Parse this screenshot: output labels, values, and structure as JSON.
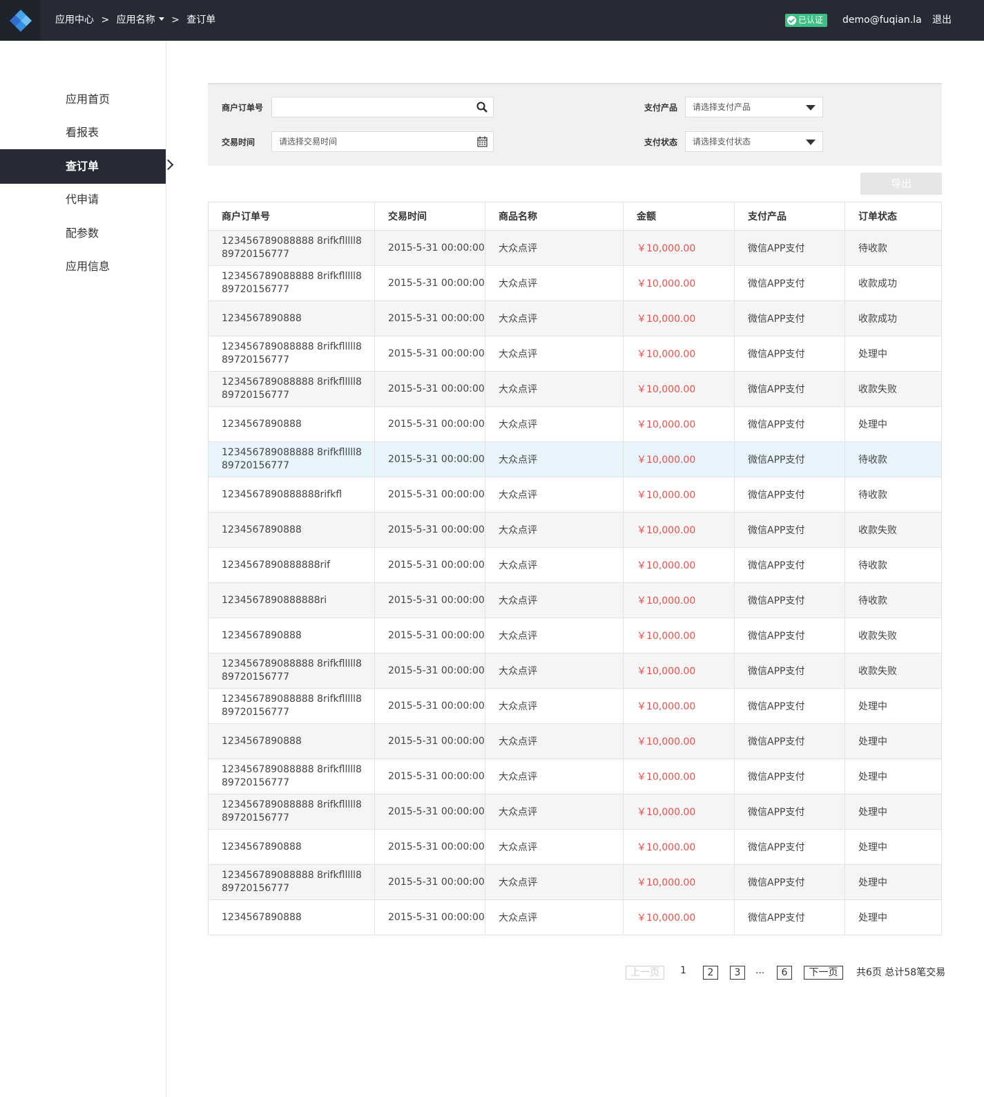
{
  "header": {
    "breadcrumb": [
      "应用中心",
      "应用名称",
      "查订单"
    ],
    "separator": ">",
    "verified_label": "已认证",
    "user_email": "demo@fuqian.la",
    "logout_label": "退出"
  },
  "sidebar": {
    "items": [
      {
        "label": "应用首页",
        "active": false
      },
      {
        "label": "看报表",
        "active": false
      },
      {
        "label": "查订单",
        "active": true
      },
      {
        "label": "代申请",
        "active": false
      },
      {
        "label": "配参数",
        "active": false
      },
      {
        "label": "应用信息",
        "active": false
      }
    ]
  },
  "filters": {
    "order_no_label": "商户订单号",
    "order_no_value": "",
    "time_label": "交易时间",
    "time_placeholder": "请选择交易时间",
    "product_label": "支付产品",
    "product_placeholder": "请选择支付产品",
    "status_label": "支付状态",
    "status_placeholder": "请选择支付状态"
  },
  "export_label": "导出",
  "table": {
    "columns": [
      "商户订单号",
      "交易时间",
      "商品名称",
      "金额",
      "支付产品",
      "订单状态"
    ],
    "rows": [
      {
        "order": "123456789088888 8rifkflllll889720156777",
        "time": "2015-5-31 00:00:00",
        "goods": "大众点评",
        "amount": "￥10,000.00",
        "product": "微信APP支付",
        "status": "待收款"
      },
      {
        "order": "123456789088888 8rifkflllll889720156777",
        "time": "2015-5-31 00:00:00",
        "goods": "大众点评",
        "amount": "￥10,000.00",
        "product": "微信APP支付",
        "status": "收款成功"
      },
      {
        "order": "1234567890888",
        "time": "2015-5-31 00:00:00",
        "goods": "大众点评",
        "amount": "￥10,000.00",
        "product": "微信APP支付",
        "status": "收款成功"
      },
      {
        "order": "123456789088888 8rifkflllll889720156777",
        "time": "2015-5-31 00:00:00",
        "goods": "大众点评",
        "amount": "￥10,000.00",
        "product": "微信APP支付",
        "status": "处理中"
      },
      {
        "order": "123456789088888 8rifkflllll889720156777",
        "time": "2015-5-31 00:00:00",
        "goods": "大众点评",
        "amount": "￥10,000.00",
        "product": "微信APP支付",
        "status": "收款失败"
      },
      {
        "order": "1234567890888",
        "time": "2015-5-31 00:00:00",
        "goods": "大众点评",
        "amount": "￥10,000.00",
        "product": "微信APP支付",
        "status": "处理中"
      },
      {
        "order": "123456789088888 8rifkflllll889720156777",
        "time": "2015-5-31 00:00:00",
        "goods": "大众点评",
        "amount": "￥10,000.00",
        "product": "微信APP支付",
        "status": "待收款",
        "highlight": true
      },
      {
        "order": "1234567890888888rifkfl",
        "time": "2015-5-31 00:00:00",
        "goods": "大众点评",
        "amount": "￥10,000.00",
        "product": "微信APP支付",
        "status": "待收款"
      },
      {
        "order": "1234567890888",
        "time": "2015-5-31 00:00:00",
        "goods": "大众点评",
        "amount": "￥10,000.00",
        "product": "微信APP支付",
        "status": "收款失败"
      },
      {
        "order": "1234567890888888rif",
        "time": "2015-5-31 00:00:00",
        "goods": "大众点评",
        "amount": "￥10,000.00",
        "product": "微信APP支付",
        "status": "待收款"
      },
      {
        "order": "1234567890888888ri",
        "time": "2015-5-31 00:00:00",
        "goods": "大众点评",
        "amount": "￥10,000.00",
        "product": "微信APP支付",
        "status": "待收款"
      },
      {
        "order": "1234567890888",
        "time": "2015-5-31 00:00:00",
        "goods": "大众点评",
        "amount": "￥10,000.00",
        "product": "微信APP支付",
        "status": "收款失败"
      },
      {
        "order": "123456789088888 8rifkflllll889720156777",
        "time": "2015-5-31 00:00:00",
        "goods": "大众点评",
        "amount": "￥10,000.00",
        "product": "微信APP支付",
        "status": "收款失败"
      },
      {
        "order": "123456789088888 8rifkflllll889720156777",
        "time": "2015-5-31 00:00:00",
        "goods": "大众点评",
        "amount": "￥10,000.00",
        "product": "微信APP支付",
        "status": "处理中"
      },
      {
        "order": "1234567890888",
        "time": "2015-5-31 00:00:00",
        "goods": "大众点评",
        "amount": "￥10,000.00",
        "product": "微信APP支付",
        "status": "处理中"
      },
      {
        "order": "123456789088888 8rifkflllll889720156777",
        "time": "2015-5-31 00:00:00",
        "goods": "大众点评",
        "amount": "￥10,000.00",
        "product": "微信APP支付",
        "status": "处理中"
      },
      {
        "order": "123456789088888 8rifkflllll889720156777",
        "time": "2015-5-31 00:00:00",
        "goods": "大众点评",
        "amount": "￥10,000.00",
        "product": "微信APP支付",
        "status": "处理中"
      },
      {
        "order": "1234567890888",
        "time": "2015-5-31 00:00:00",
        "goods": "大众点评",
        "amount": "￥10,000.00",
        "product": "微信APP支付",
        "status": "处理中"
      },
      {
        "order": "123456789088888 8rifkflllll889720156777",
        "time": "2015-5-31 00:00:00",
        "goods": "大众点评",
        "amount": "￥10,000.00",
        "product": "微信APP支付",
        "status": "处理中"
      },
      {
        "order": "1234567890888",
        "time": "2015-5-31 00:00:00",
        "goods": "大众点评",
        "amount": "￥10,000.00",
        "product": "微信APP支付",
        "status": "处理中"
      }
    ]
  },
  "pagination": {
    "prev_label": "上一页",
    "pages": [
      "1",
      "2",
      "3",
      "6"
    ],
    "current_page": "1",
    "ellipsis": "...",
    "next_label": "下一页",
    "summary": "共6页 总计58笔交易"
  },
  "colors": {
    "topbar": "#262a35",
    "accent_green": "#3dbf85",
    "amount_red": "#e8504c",
    "highlight_row": "#e8f4fb"
  }
}
